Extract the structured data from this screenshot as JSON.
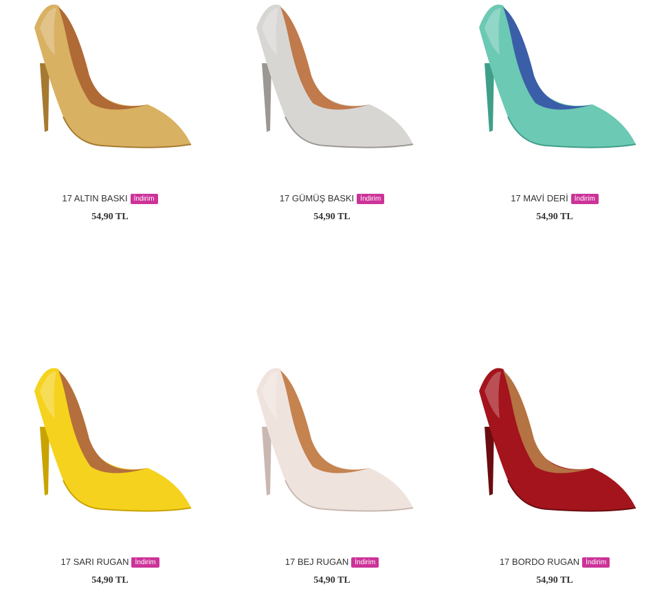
{
  "products": [
    {
      "name": "17 ALTIN BASKI",
      "badge": "İndirim",
      "price": "54,90 TL",
      "color": "#d9b163",
      "shade": "#a57a30",
      "lining": "#b06a36"
    },
    {
      "name": "17 GÜMÜŞ BASKI",
      "badge": "İndirim",
      "price": "54,90 TL",
      "color": "#d8d6d3",
      "shade": "#9b9894",
      "lining": "#c07a4b"
    },
    {
      "name": "17 MAVİ DERİ",
      "badge": "İndirim",
      "price": "54,90 TL",
      "color": "#6cc9b3",
      "shade": "#3f9f89",
      "lining": "#3b5ea8"
    },
    {
      "name": "17 SARI RUGAN",
      "badge": "İndirim",
      "price": "54,90 TL",
      "color": "#f5d21d",
      "shade": "#c9a300",
      "lining": "#b56f3c"
    },
    {
      "name": "17 BEJ RUGAN",
      "badge": "İndirim",
      "price": "54,90 TL",
      "color": "#efe3de",
      "shade": "#c8b8b1",
      "lining": "#c58350"
    },
    {
      "name": "17 BORDO RUGAN",
      "badge": "İndirim",
      "price": "54,90 TL",
      "color": "#a3141c",
      "shade": "#6a0c10",
      "lining": "#b57243"
    }
  ]
}
